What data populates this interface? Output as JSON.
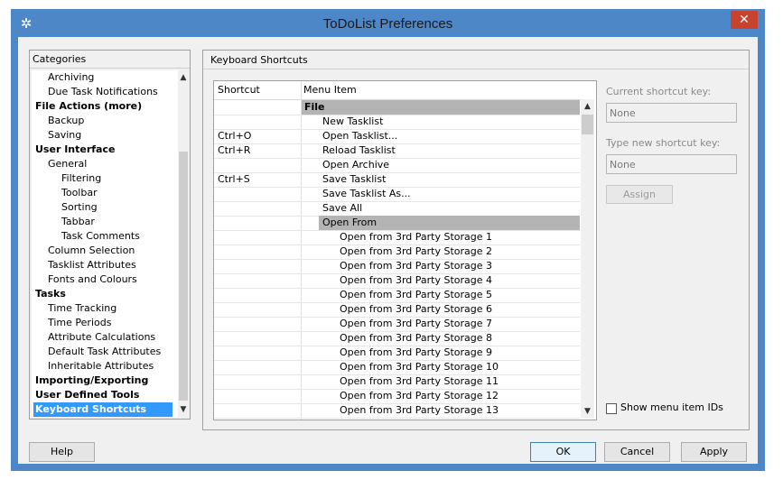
{
  "window": {
    "title": "ToDoList Preferences",
    "close_glyph": "✕",
    "app_icon_glyph": "✲",
    "title_bar_color": "#4d87c7",
    "close_color": "#c7432f"
  },
  "categories": {
    "header": "Categories",
    "selection_color": "#3399ff",
    "items": [
      {
        "label": "Archiving",
        "level": 1,
        "bold": false,
        "selected": false
      },
      {
        "label": "Due Task Notifications",
        "level": 1,
        "bold": false,
        "selected": false
      },
      {
        "label": "File Actions (more)",
        "level": 0,
        "bold": true,
        "selected": false
      },
      {
        "label": "Backup",
        "level": 1,
        "bold": false,
        "selected": false
      },
      {
        "label": "Saving",
        "level": 1,
        "bold": false,
        "selected": false
      },
      {
        "label": "User Interface",
        "level": 0,
        "bold": true,
        "selected": false
      },
      {
        "label": "General",
        "level": 1,
        "bold": false,
        "selected": false
      },
      {
        "label": "Filtering",
        "level": 2,
        "bold": false,
        "selected": false
      },
      {
        "label": "Toolbar",
        "level": 2,
        "bold": false,
        "selected": false
      },
      {
        "label": "Sorting",
        "level": 2,
        "bold": false,
        "selected": false
      },
      {
        "label": "Tabbar",
        "level": 2,
        "bold": false,
        "selected": false
      },
      {
        "label": "Task Comments",
        "level": 2,
        "bold": false,
        "selected": false
      },
      {
        "label": "Column Selection",
        "level": 1,
        "bold": false,
        "selected": false
      },
      {
        "label": "Tasklist Attributes",
        "level": 1,
        "bold": false,
        "selected": false
      },
      {
        "label": "Fonts and Colours",
        "level": 1,
        "bold": false,
        "selected": false
      },
      {
        "label": "Tasks",
        "level": 0,
        "bold": true,
        "selected": false
      },
      {
        "label": "Time Tracking",
        "level": 1,
        "bold": false,
        "selected": false
      },
      {
        "label": "Time Periods",
        "level": 1,
        "bold": false,
        "selected": false
      },
      {
        "label": "Attribute Calculations",
        "level": 1,
        "bold": false,
        "selected": false
      },
      {
        "label": "Default Task Attributes",
        "level": 1,
        "bold": false,
        "selected": false
      },
      {
        "label": "Inheritable Attributes",
        "level": 1,
        "bold": false,
        "selected": false
      },
      {
        "label": "Importing/Exporting",
        "level": 0,
        "bold": true,
        "selected": false
      },
      {
        "label": "User Defined Tools",
        "level": 0,
        "bold": true,
        "selected": false
      },
      {
        "label": "Keyboard Shortcuts",
        "level": 0,
        "bold": true,
        "selected": true
      }
    ]
  },
  "shortcuts_panel": {
    "header": "Keyboard Shortcuts",
    "col_shortcut": "Shortcut",
    "col_menu_item": "Menu Item",
    "rows": [
      {
        "shortcut": "",
        "item": "File",
        "level": 0,
        "highlight": true,
        "bold": true
      },
      {
        "shortcut": "",
        "item": "New Tasklist",
        "level": 1,
        "highlight": false,
        "bold": false
      },
      {
        "shortcut": "Ctrl+O",
        "item": "Open Tasklist...",
        "level": 1,
        "highlight": false,
        "bold": false
      },
      {
        "shortcut": "Ctrl+R",
        "item": "Reload Tasklist",
        "level": 1,
        "highlight": false,
        "bold": false
      },
      {
        "shortcut": "",
        "item": "Open Archive",
        "level": 1,
        "highlight": false,
        "bold": false
      },
      {
        "shortcut": "Ctrl+S",
        "item": "Save Tasklist",
        "level": 1,
        "highlight": false,
        "bold": false
      },
      {
        "shortcut": "",
        "item": "Save Tasklist As...",
        "level": 1,
        "highlight": false,
        "bold": false
      },
      {
        "shortcut": "",
        "item": "Save All",
        "level": 1,
        "highlight": false,
        "bold": false
      },
      {
        "shortcut": "",
        "item": "Open From",
        "level": 1,
        "highlight": true,
        "bold": false
      },
      {
        "shortcut": "",
        "item": "Open from 3rd Party Storage 1",
        "level": 2,
        "highlight": false,
        "bold": false
      },
      {
        "shortcut": "",
        "item": "Open from 3rd Party Storage 2",
        "level": 2,
        "highlight": false,
        "bold": false
      },
      {
        "shortcut": "",
        "item": "Open from 3rd Party Storage 3",
        "level": 2,
        "highlight": false,
        "bold": false
      },
      {
        "shortcut": "",
        "item": "Open from 3rd Party Storage 4",
        "level": 2,
        "highlight": false,
        "bold": false
      },
      {
        "shortcut": "",
        "item": "Open from 3rd Party Storage 5",
        "level": 2,
        "highlight": false,
        "bold": false
      },
      {
        "shortcut": "",
        "item": "Open from 3rd Party Storage 6",
        "level": 2,
        "highlight": false,
        "bold": false
      },
      {
        "shortcut": "",
        "item": "Open from 3rd Party Storage 7",
        "level": 2,
        "highlight": false,
        "bold": false
      },
      {
        "shortcut": "",
        "item": "Open from 3rd Party Storage 8",
        "level": 2,
        "highlight": false,
        "bold": false
      },
      {
        "shortcut": "",
        "item": "Open from 3rd Party Storage 9",
        "level": 2,
        "highlight": false,
        "bold": false
      },
      {
        "shortcut": "",
        "item": "Open from 3rd Party Storage 10",
        "level": 2,
        "highlight": false,
        "bold": false
      },
      {
        "shortcut": "",
        "item": "Open from 3rd Party Storage 11",
        "level": 2,
        "highlight": false,
        "bold": false
      },
      {
        "shortcut": "",
        "item": "Open from 3rd Party Storage 12",
        "level": 2,
        "highlight": false,
        "bold": false
      },
      {
        "shortcut": "",
        "item": "Open from 3rd Party Storage 13",
        "level": 2,
        "highlight": false,
        "bold": false
      }
    ],
    "current_key_label": "Current shortcut key:",
    "current_key_value": "None",
    "new_key_label": "Type new shortcut key:",
    "new_key_value": "None",
    "assign_label": "Assign",
    "show_ids_label": "Show menu item IDs",
    "show_ids_checked": false
  },
  "footer": {
    "help_label": "Help",
    "ok_label": "OK",
    "cancel_label": "Cancel",
    "apply_label": "Apply"
  }
}
